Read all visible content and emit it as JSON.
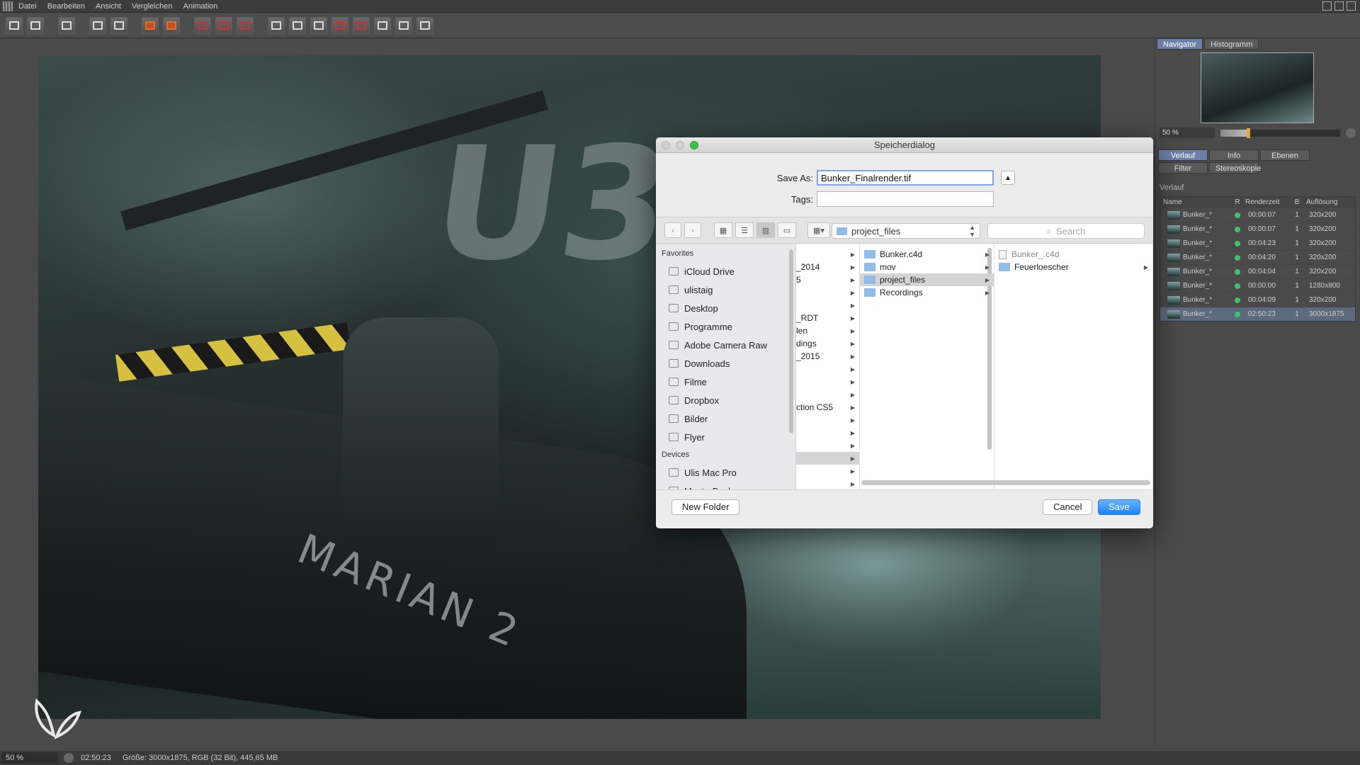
{
  "menubar": {
    "items": [
      "Datei",
      "Bearbeiten",
      "Ansicht",
      "Vergleichen",
      "Animation"
    ]
  },
  "toolbar": {
    "icons": [
      "open-file-icon",
      "save-icon",
      "grid-icon",
      "grid-move-icon",
      "person-icon",
      "layers-icon",
      "layers-alt-icon",
      "frame-icon",
      "frame-alt-icon",
      "frame-record-icon",
      "compare-ab-icon",
      "compare-split-icon",
      "compare-alt-icon",
      "letter-a-icon",
      "letter-b-icon",
      "split-view-icon",
      "split-view-alt-icon",
      "split-view-third-icon"
    ]
  },
  "viewport": {
    "big_letters": "U3",
    "hull_name": "MARIAN 2"
  },
  "right_panel": {
    "top_tabs": [
      "Navigator",
      "Histogramm"
    ],
    "zoom_value": "50 %",
    "zoom_fraction": 0.22,
    "tabs_row1": [
      "Verlauf",
      "Info",
      "Ebenen"
    ],
    "tabs_row2": [
      "Filter",
      "Stereoskopie"
    ],
    "section_title": "Verlauf",
    "columns": [
      "Name",
      "R",
      "Renderzeit",
      "B",
      "Auflösung"
    ],
    "rows": [
      {
        "name": "Bunker_*",
        "time": "00:00:07",
        "b": "1",
        "res": "320x200"
      },
      {
        "name": "Bunker_*",
        "time": "00:00:07",
        "b": "1",
        "res": "320x200"
      },
      {
        "name": "Bunker_*",
        "time": "00:04:23",
        "b": "1",
        "res": "320x200"
      },
      {
        "name": "Bunker_*",
        "time": "00:04:20",
        "b": "1",
        "res": "320x200"
      },
      {
        "name": "Bunker_*",
        "time": "00:04:04",
        "b": "1",
        "res": "320x200"
      },
      {
        "name": "Bunker_*",
        "time": "00:00:00",
        "b": "1",
        "res": "1280x800"
      },
      {
        "name": "Bunker_*",
        "time": "00:04:09",
        "b": "1",
        "res": "320x200"
      },
      {
        "name": "Bunker_*",
        "time": "02:50:23",
        "b": "1",
        "res": "3000x1875"
      }
    ],
    "status_color": "#3ec46d"
  },
  "statusbar": {
    "zoom": "50 %",
    "time": "02:50:23",
    "info": "Größe: 3000x1875, RGB (32 Bit), 445,65 MB"
  },
  "dialog": {
    "title": "Speicherdialog",
    "save_as_label": "Save As:",
    "save_as_value": "Bunker_Finalrender.tif",
    "tags_label": "Tags:",
    "tags_value": "",
    "path": "project_files",
    "search_placeholder": "Search",
    "favorites_head": "Favorites",
    "favorites": [
      {
        "label": "iCloud Drive",
        "icon": "cloud-icon"
      },
      {
        "label": "ulistaig",
        "icon": "home-icon"
      },
      {
        "label": "Desktop",
        "icon": "desktop-icon"
      },
      {
        "label": "Programme",
        "icon": "apps-icon"
      },
      {
        "label": "Adobe Camera Raw",
        "icon": "folder-icon"
      },
      {
        "label": "Downloads",
        "icon": "download-icon"
      },
      {
        "label": "Filme",
        "icon": "film-icon"
      },
      {
        "label": "Dropbox",
        "icon": "dropbox-icon"
      },
      {
        "label": "Bilder",
        "icon": "camera-icon"
      },
      {
        "label": "Flyer",
        "icon": "gear-icon"
      }
    ],
    "devices_head": "Devices",
    "devices": [
      {
        "label": "Ulis Mac Pro",
        "icon": "computer-icon"
      },
      {
        "label": "MasterBackup",
        "icon": "drive-icon"
      }
    ],
    "col1": [
      "",
      "_2014",
      "5",
      "",
      "",
      "_RDT",
      "len",
      "dings",
      "_2015",
      "",
      "",
      "",
      "ction CS5",
      "",
      "",
      "",
      "",
      "",
      ""
    ],
    "col2": [
      {
        "label": "Bunker.c4d",
        "selected": false
      },
      {
        "label": "mov",
        "selected": false
      },
      {
        "label": "project_files",
        "selected": true
      },
      {
        "label": "Recordings",
        "selected": false
      }
    ],
    "col3": [
      {
        "label": "Bunker_.c4d",
        "type": "file"
      },
      {
        "label": "Feuerloescher",
        "type": "folder"
      }
    ],
    "new_folder_label": "New Folder",
    "cancel_label": "Cancel",
    "save_label": "Save",
    "accent": "#1a82fb"
  }
}
